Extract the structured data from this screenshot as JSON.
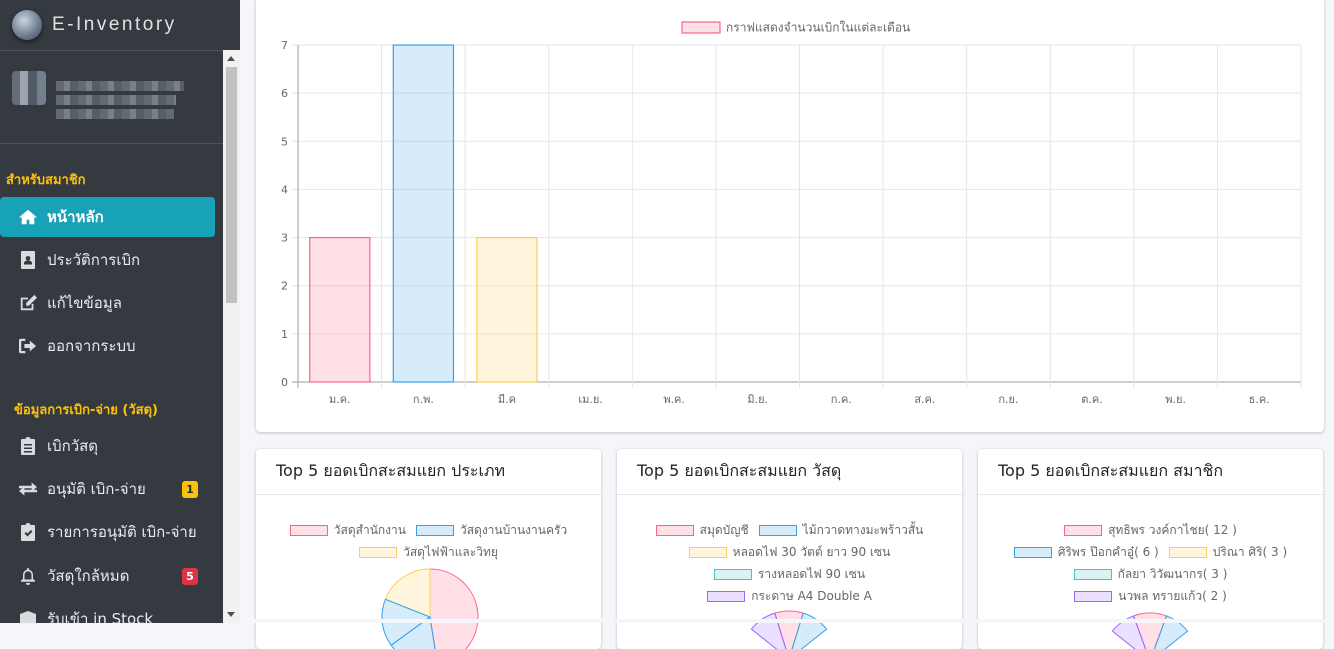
{
  "app": {
    "brand": "E-Inventory"
  },
  "sidebar": {
    "section1": "สำหรับสมาชิก",
    "section2": "ข้อมูลการเบิก-จ่าย (วัสดุ)",
    "items": [
      {
        "label": "หน้าหลัก",
        "icon": "home-icon"
      },
      {
        "label": "ประวัติการเบิก",
        "icon": "id-badge-icon"
      },
      {
        "label": "แก้ไขข้อมูล",
        "icon": "edit-icon"
      },
      {
        "label": "ออกจากระบบ",
        "icon": "sign-out-icon"
      },
      {
        "label": "เบิกวัสดุ",
        "icon": "clipboard-list-icon"
      },
      {
        "label": "อนุมัติ เบิก-จ่าย",
        "icon": "exchange-icon",
        "badge": "1"
      },
      {
        "label": "รายการอนุมัติ เบิก-จ่าย",
        "icon": "clipboard-check-icon"
      },
      {
        "label": "วัสดุใกล้หมด",
        "icon": "bell-icon",
        "badge": "5"
      },
      {
        "label": "รับเข้า in Stock",
        "icon": "box-icon"
      }
    ]
  },
  "colors": {
    "pink": "#ff6384",
    "blue": "#36a2eb",
    "yellow": "#ffce56",
    "teal": "#4bc0c0",
    "purple": "#9966ff",
    "active": "#17a2b8"
  },
  "chart_data": [
    {
      "type": "bar",
      "categories": [
        "ม.ค.",
        "ก.พ.",
        "มี.ค",
        "เม.ย.",
        "พ.ค.",
        "มิ.ย.",
        "ก.ค.",
        "ส.ค.",
        "ก.ย.",
        "ต.ค.",
        "พ.ย.",
        "ธ.ค."
      ],
      "series": [
        {
          "name": "กราฟแสดงจำนวนเบิกในแต่ละเดือน",
          "values": [
            3,
            7,
            3,
            0,
            0,
            0,
            0,
            0,
            0,
            0,
            0,
            0
          ]
        }
      ],
      "ylim": [
        0,
        7
      ],
      "yticks": [
        0,
        1,
        2,
        3,
        4,
        5,
        6,
        7
      ],
      "grid": true,
      "legend": "top-center"
    },
    {
      "type": "pie",
      "title": "Top 5 ยอดเบิกสะสมแยก ประเภท",
      "labels": [
        "วัสดุสำนักงาน",
        "วัสดุงานบ้านงานครัว",
        "วัสดุไฟฟ้าและวิทยุ"
      ],
      "legend": "top"
    },
    {
      "type": "pie",
      "title": "Top 5 ยอดเบิกสะสมแยก วัสดุ",
      "labels": [
        "สมุดบัญชี",
        "ไม้กวาดทางมะพร้าวสั้น",
        "หลอดไฟ 30 วัตต์ ยาว 90 เซน",
        "รางหลอดไฟ 90 เซน",
        "กระดาษ A4 Double A"
      ],
      "legend": "top"
    },
    {
      "type": "pie",
      "title": "Top 5 ยอดเบิกสะสมแยก สมาชิก",
      "labels": [
        "สุทธิพร วงค์กาไชย( 12 )",
        "ศิริพร ป๊อกคำอู๋( 6 )",
        "ปริณา ศิริ( 3 )",
        "กัลยา วิวัฒนากร( 3 )",
        "นวพล ทรายแก้ว( 2 )"
      ],
      "legend": "top"
    }
  ],
  "cards": {
    "type_title": "Top 5 ยอดเบิกสะสมแยก ประเภท",
    "material_title": "Top 5 ยอดเบิกสะสมแยก วัสดุ",
    "member_title": "Top 5 ยอดเบิกสะสมแยก สมาชิก"
  }
}
